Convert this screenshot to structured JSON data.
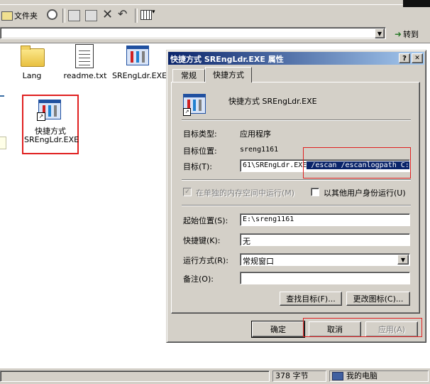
{
  "toolbar": {
    "folders_label": "文件夹",
    "go_label": "转到"
  },
  "files": [
    {
      "name": "Lang",
      "icon": "folder-icon"
    },
    {
      "name": "readme.txt",
      "icon": "text-file-icon"
    },
    {
      "name": "SREngLdr.EXE",
      "icon": "application-icon"
    }
  ],
  "desktop_shortcut": {
    "line1": "快捷方式",
    "line2": "SREngLdr.EXE"
  },
  "dialog": {
    "title": "快捷方式 SREngLdr.EXE 属性",
    "help_btn": "?",
    "close_btn": "✕",
    "tabs": [
      {
        "label": "常规",
        "active": false
      },
      {
        "label": "快捷方式",
        "active": true
      }
    ],
    "shortcut_name": "快捷方式 SREngLdr.EXE",
    "target_type_label": "目标类型:",
    "target_type_value": "应用程序",
    "target_location_label": "目标位置:",
    "target_location_value": "sreng1161",
    "target_label": "目标(T):",
    "target_value_plain": "61\\SREngLdr.EXE",
    "target_value_selected": " /escan /escanlogpath C:",
    "run_separate_label": "在单独的内存空间中运行(M)",
    "run_as_label": "以其他用户身份运行(U)",
    "start_in_label": "起始位置(S):",
    "start_in_value": "E:\\sreng1161",
    "shortcut_key_label": "快捷键(K):",
    "shortcut_key_value": "无",
    "run_label": "运行方式(R):",
    "run_value": "常规窗口",
    "comment_label": "备注(O):",
    "comment_value": "",
    "find_target_btn": "查找目标(F)...",
    "change_icon_btn": "更改图标(C)...",
    "ok_btn": "确定",
    "cancel_btn": "取消",
    "apply_btn": "应用(A)"
  },
  "statusbar": {
    "size": "378 字节",
    "location": "我的电脑"
  },
  "colors": {
    "title_bar": "#0a246a",
    "highlight": "#0a246a",
    "annotation_red": "#e02020"
  }
}
